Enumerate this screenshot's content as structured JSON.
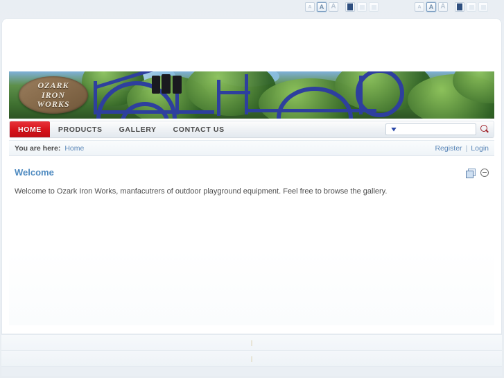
{
  "accessibility": {
    "font_small_label": "A",
    "font_medium_label": "A",
    "font_large_label": "A",
    "selected_font": "medium",
    "groups": 2
  },
  "banner": {
    "sign_line1": "OZARK",
    "sign_line2": "IRON",
    "sign_line3": "WORKS",
    "alt": "Blue metal playground car sculpture among green trees"
  },
  "nav": {
    "items": [
      {
        "label": "HOME",
        "active": true
      },
      {
        "label": "PRODUCTS",
        "active": false
      },
      {
        "label": "GALLERY",
        "active": false
      },
      {
        "label": "CONTACT US",
        "active": false
      }
    ]
  },
  "search": {
    "value": "",
    "placeholder": "",
    "go_title": "Search"
  },
  "breadcrumb": {
    "label": "You are here:",
    "current": "Home"
  },
  "auth": {
    "register": "Register",
    "separator": "|",
    "login": "Login"
  },
  "article": {
    "title": "Welcome",
    "body": "Welcome to Ozark Iron Works, manfacutrers of outdoor playground equipment. Feel free to browse the gallery.",
    "print_title": "Print",
    "collapse_title": "Collapse"
  },
  "footer": {
    "row1": "|",
    "row2": "|"
  },
  "colors": {
    "accent_red": "#d6121a",
    "link_blue": "#5b87b8",
    "heading_blue": "#4e8ac0",
    "page_bg": "#edf1f5"
  }
}
